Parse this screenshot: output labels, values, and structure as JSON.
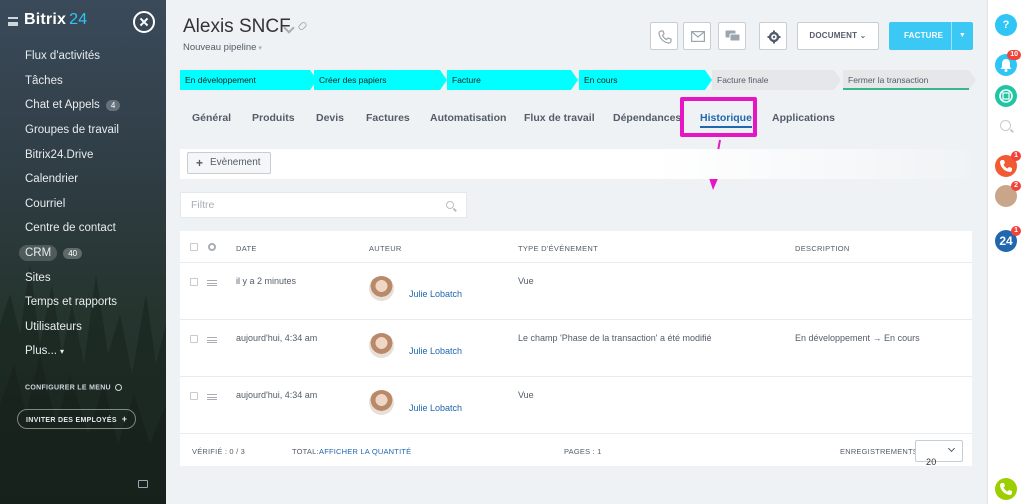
{
  "sidebar": {
    "brand_name": "Bitrix",
    "brand_num": "24",
    "items": [
      {
        "label": "Flux d'activités"
      },
      {
        "label": "Tâches"
      },
      {
        "label": "Chat et Appels",
        "badge": "4"
      },
      {
        "label": "Groupes de travail"
      },
      {
        "label": "Bitrix24.Drive"
      },
      {
        "label": "Calendrier"
      },
      {
        "label": "Courriel"
      },
      {
        "label": "Centre de contact"
      },
      {
        "label": "CRM",
        "badge": "40"
      },
      {
        "label": "Sites"
      },
      {
        "label": "Temps et rapports"
      },
      {
        "label": "Utilisateurs"
      },
      {
        "label": "Plus..."
      }
    ],
    "configure_label": "CONFIGURER LE MENU",
    "invite_label": "INVITER DES EMPLOYÉS",
    "invite_plus": "+"
  },
  "header": {
    "title": "Alexis SNCF",
    "pipeline": "Nouveau pipeline",
    "document_label": "DOCUMENT",
    "facture_label": "FACTURE"
  },
  "stages": [
    {
      "label": "En développement",
      "state": "on"
    },
    {
      "label": "Créer des papiers",
      "state": "on"
    },
    {
      "label": "Facture",
      "state": "on"
    },
    {
      "label": "En cours",
      "state": "on"
    },
    {
      "label": "Facture finale",
      "state": "off"
    },
    {
      "label": "Fermer la transaction",
      "state": "off"
    }
  ],
  "tabs": [
    {
      "label": "Général"
    },
    {
      "label": "Produits"
    },
    {
      "label": "Devis"
    },
    {
      "label": "Factures"
    },
    {
      "label": "Automatisation"
    },
    {
      "label": "Flux de travail"
    },
    {
      "label": "Dépendances"
    },
    {
      "label": "Historique",
      "active": true
    },
    {
      "label": "Applications"
    }
  ],
  "toolbar": {
    "event_plus": "+",
    "event_label": "Evènement"
  },
  "filter": {
    "placeholder": "Filtre"
  },
  "grid": {
    "columns": [
      "DATE",
      "AUTEUR",
      "TYPE D'ÉVÉNEMENT",
      "DESCRIPTION"
    ],
    "rows": [
      {
        "date": "il y a 2 minutes",
        "author": "Julie Lobatch",
        "type": "Vue",
        "description": ""
      },
      {
        "date": "aujourd'hui, 4:34 am",
        "author": "Julie Lobatch",
        "type": "Le champ 'Phase de la transaction' a été modifié",
        "description": "En développement → En cours"
      },
      {
        "date": "aujourd'hui, 4:34 am",
        "author": "Julie Lobatch",
        "type": "Vue",
        "description": ""
      }
    ],
    "footer": {
      "checked": "VÉRIFIÉ : 0 / 3",
      "total_label": "TOTAL:",
      "total_link": "AFFICHER LA QUANTITÉ",
      "pages": "PAGES : 1",
      "records_label": "ENREGISTREMENTS :",
      "records_value": "20"
    }
  },
  "rightbar": {
    "help": "?",
    "bell_badge": "10",
    "phone_badge": "1",
    "avatars_badge": "2",
    "b24_label": "24",
    "b24_badge": "1"
  },
  "colors": {
    "accent": "#3bc8f5",
    "stage_active": "#00ffff",
    "highlight": "#e616c7",
    "link": "#2067b0"
  }
}
